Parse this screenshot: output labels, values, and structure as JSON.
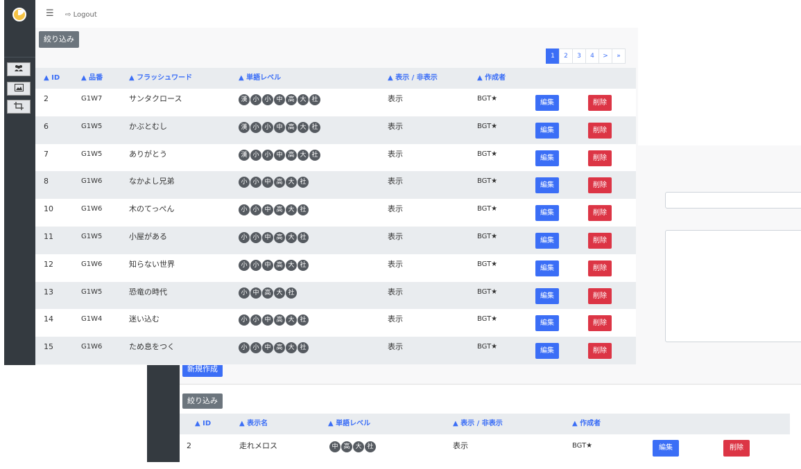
{
  "topbar": {
    "menu_icon": "☰",
    "logout_label": "Logout"
  },
  "sidebar": {
    "items": [
      {
        "icon": "users-icon"
      },
      {
        "icon": "image-icon"
      },
      {
        "icon": "crop-icon"
      }
    ]
  },
  "main": {
    "filter_label": "絞り込み",
    "pagination": [
      "1",
      "2",
      "3",
      "4",
      ">",
      "»"
    ],
    "pagination_active": "1",
    "columns": [
      "▲ ID",
      "▲ 品番",
      "▲ フラッシュワード",
      "▲ 単語レベル",
      "▲ 表示 / 非表示",
      "▲ 作成者"
    ],
    "edit_label": "編集",
    "delete_label": "削除",
    "rows": [
      {
        "id": "2",
        "code": "G1W7",
        "word": "サンタクロース",
        "levels": [
          "漢",
          "小",
          "小",
          "中",
          "高",
          "大",
          "社"
        ],
        "visibility": "表示",
        "author": "BGT★"
      },
      {
        "id": "6",
        "code": "G1W5",
        "word": "かぶとむし",
        "levels": [
          "漢",
          "小",
          "小",
          "中",
          "高",
          "大",
          "社"
        ],
        "visibility": "表示",
        "author": "BGT★"
      },
      {
        "id": "7",
        "code": "G1W5",
        "word": "ありがとう",
        "levels": [
          "漢",
          "小",
          "小",
          "中",
          "高",
          "大",
          "社"
        ],
        "visibility": "表示",
        "author": "BGT★"
      },
      {
        "id": "8",
        "code": "G1W6",
        "word": "なかよし兄弟",
        "levels": [
          "小",
          "小",
          "中",
          "高",
          "大",
          "社"
        ],
        "visibility": "表示",
        "author": "BGT★"
      },
      {
        "id": "10",
        "code": "G1W6",
        "word": "木のてっぺん",
        "levels": [
          "小",
          "小",
          "中",
          "高",
          "大",
          "社"
        ],
        "visibility": "表示",
        "author": "BGT★"
      },
      {
        "id": "11",
        "code": "G1W5",
        "word": "小屋がある",
        "levels": [
          "小",
          "小",
          "中",
          "高",
          "大",
          "社"
        ],
        "visibility": "表示",
        "author": "BGT★"
      },
      {
        "id": "12",
        "code": "G1W6",
        "word": "知らない世界",
        "levels": [
          "小",
          "小",
          "中",
          "高",
          "大",
          "社"
        ],
        "visibility": "表示",
        "author": "BGT★"
      },
      {
        "id": "13",
        "code": "G1W5",
        "word": "恐竜の時代",
        "levels": [
          "小",
          "中",
          "高",
          "大",
          "社"
        ],
        "visibility": "表示",
        "author": "BGT★"
      },
      {
        "id": "14",
        "code": "G1W4",
        "word": "迷い込む",
        "levels": [
          "小",
          "小",
          "中",
          "高",
          "大",
          "社"
        ],
        "visibility": "表示",
        "author": "BGT★"
      },
      {
        "id": "15",
        "code": "G1W6",
        "word": "ため息をつく",
        "levels": [
          "小",
          "小",
          "中",
          "高",
          "大",
          "社"
        ],
        "visibility": "表示",
        "author": "BGT★"
      }
    ]
  },
  "back_window": {
    "new_label": "新規作成",
    "filter_label": "絞り込み",
    "columns": [
      "▲ ID",
      "▲ 表示名",
      "▲ 単語レベル",
      "▲ 表示 / 非表示",
      "▲ 作成者"
    ],
    "row": {
      "id": "2",
      "name": "走れメロス",
      "levels": [
        "中",
        "高",
        "大",
        "社"
      ],
      "visibility": "表示",
      "author": "BGT★"
    },
    "edit_label": "編集",
    "delete_label": "削除"
  },
  "colors": {
    "primary": "#3b6ef6",
    "danger": "#dc3545",
    "sidebar": "#343a40",
    "secondary": "#6c757d"
  }
}
